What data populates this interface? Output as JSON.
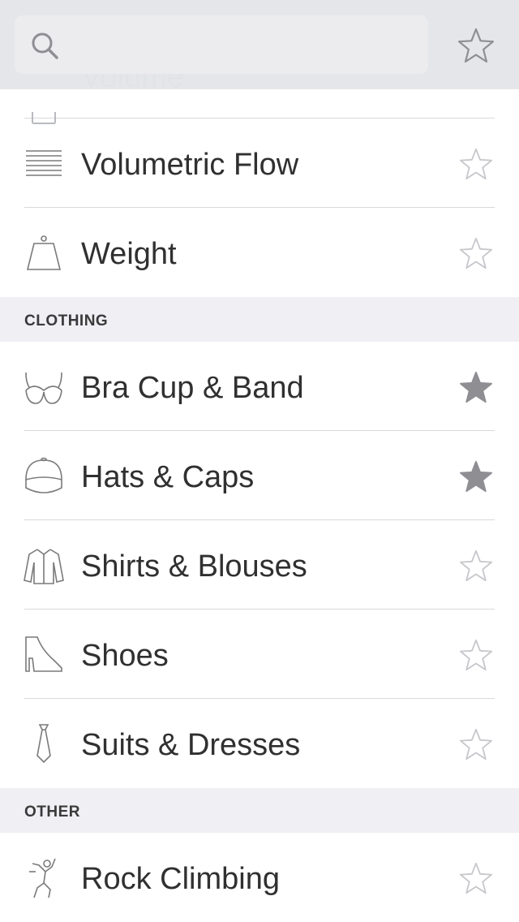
{
  "search": {
    "placeholder": "",
    "value": ""
  },
  "peek_item": {
    "label": "Volume"
  },
  "sections": {
    "clothing": "CLOTHING",
    "other": "OTHER"
  },
  "items": [
    {
      "label": "Volumetric Flow",
      "favorite": false,
      "icon": "volumetric-flow-icon"
    },
    {
      "label": "Weight",
      "favorite": false,
      "icon": "weight-icon"
    },
    {
      "label": "Bra Cup & Band",
      "favorite": true,
      "icon": "bra-icon"
    },
    {
      "label": "Hats & Caps",
      "favorite": true,
      "icon": "cap-icon"
    },
    {
      "label": "Shirts & Blouses",
      "favorite": false,
      "icon": "shirt-icon"
    },
    {
      "label": "Shoes",
      "favorite": false,
      "icon": "shoe-icon"
    },
    {
      "label": "Suits & Dresses",
      "favorite": false,
      "icon": "tie-icon"
    },
    {
      "label": "Rock Climbing",
      "favorite": false,
      "icon": "climber-icon"
    }
  ],
  "colors": {
    "star_filled": "#8e8e93",
    "star_outline": "#c7c7cc",
    "section_bg": "#efeff4",
    "header_bg": "#e2e4e7"
  }
}
